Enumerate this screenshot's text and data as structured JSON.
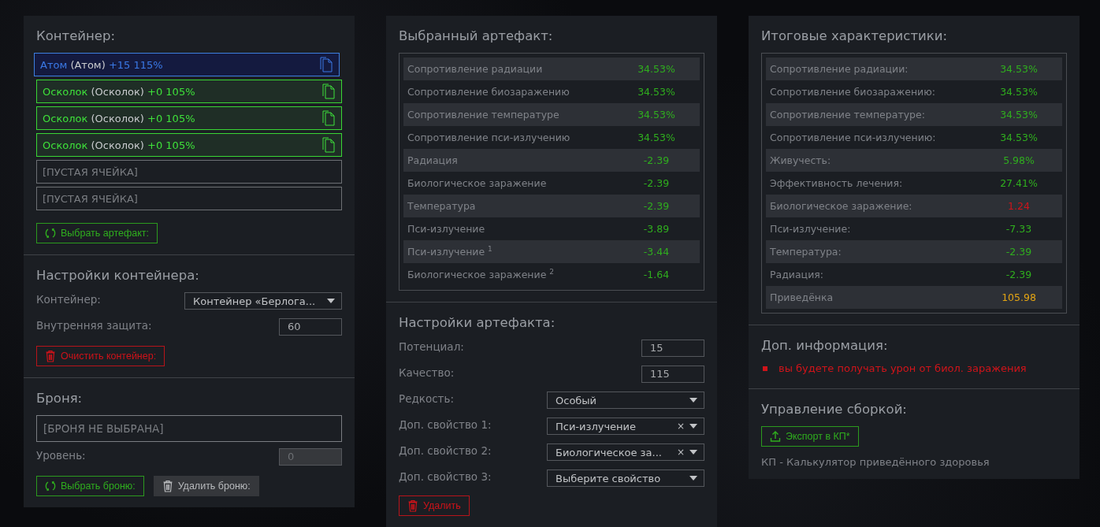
{
  "container": {
    "title": "Контейнер:",
    "slots": [
      {
        "kind": "artifact",
        "selected": true,
        "name": "Атом",
        "type": "(Атом)",
        "bonus": "+15 115%"
      },
      {
        "kind": "artifact",
        "selected": false,
        "name": "Осколок",
        "type": "(Осколок)",
        "bonus": "+0 105%"
      },
      {
        "kind": "artifact",
        "selected": false,
        "name": "Осколок",
        "type": "(Осколок)",
        "bonus": "+0 105%"
      },
      {
        "kind": "artifact",
        "selected": false,
        "name": "Осколок",
        "type": "(Осколок)",
        "bonus": "+0 105%"
      },
      {
        "kind": "empty",
        "label": "[ПУСТАЯ ЯЧЕЙКА]"
      },
      {
        "kind": "empty",
        "label": "[ПУСТАЯ ЯЧЕЙКА]"
      }
    ],
    "button": {
      "kind": "select",
      "label": "Выбрать артефакт:"
    }
  },
  "container_settings": {
    "title": "Настройки контейнера:",
    "fields": [
      {
        "kind": "select",
        "label": "Контейнер:",
        "value": "Контейнер «Берлога...",
        "disabled": false
      },
      {
        "kind": "input",
        "label": "Внутренняя защита:",
        "value": "60",
        "disabled": false
      }
    ],
    "buttons": [
      {
        "kind": "danger",
        "label": "Очистить контейнер:"
      }
    ]
  },
  "armor": {
    "title": "Броня:",
    "slot": "[БРОНЯ НЕ ВЫБРАНА]",
    "fields": [
      {
        "kind": "input",
        "label": "Уровень:",
        "value": "0",
        "disabled": true
      }
    ],
    "buttons": [
      {
        "kind": "select",
        "label": "Выбрать броню:"
      },
      {
        "kind": "muted",
        "label": "Удалить броню:"
      }
    ]
  },
  "selected_artifact": {
    "title": "Выбранный артефакт:",
    "stats": [
      {
        "label": "Сопротивление радиации",
        "value": "34.53%",
        "color": "#2fae1e"
      },
      {
        "label": "Сопротивление биозаражению",
        "value": "34.53%",
        "color": "#2fae1e"
      },
      {
        "label": "Сопротивление температуре",
        "value": "34.53%",
        "color": "#2fae1e"
      },
      {
        "label": "Сопротивление пси-излучению",
        "value": "34.53%",
        "color": "#2fae1e"
      },
      {
        "label": "Радиация",
        "value": "-2.39",
        "color": "#2fae1e"
      },
      {
        "label": "Биологическое заражение",
        "value": "-2.39",
        "color": "#2fae1e"
      },
      {
        "label": "Температура",
        "value": "-2.39",
        "color": "#2fae1e"
      },
      {
        "label": "Пси-излучение",
        "value": "-3.89",
        "color": "#2fae1e"
      },
      {
        "label": "Пси-излучение $^{1}$",
        "value": "-3.44",
        "color": "#2fae1e"
      },
      {
        "label": "Биологическое заражение $^{2}$",
        "value": "-1.64",
        "color": "#2fae1e"
      }
    ]
  },
  "artifact_settings": {
    "title": "Настройки артефакта:",
    "fields": [
      {
        "kind": "input",
        "label": "Потенциал:",
        "value": "15",
        "disabled": false
      },
      {
        "kind": "input",
        "label": "Качество:",
        "value": "115",
        "disabled": false
      },
      {
        "kind": "select",
        "label": "Редкость:",
        "value": "Особый",
        "disabled": false
      },
      {
        "kind": "select",
        "label": "Доп. свойство 1:",
        "value": "Пси-излучение",
        "clear": "×",
        "disabled": false
      },
      {
        "kind": "select",
        "label": "Доп. свойство 2:",
        "value": "Биологическое за...",
        "clear": "×",
        "disabled": false
      },
      {
        "kind": "select",
        "label": "Доп. свойство 3:",
        "value": "Выберите свойство",
        "disabled": false
      }
    ],
    "buttons": [
      {
        "kind": "danger",
        "label": "Удалить"
      }
    ]
  },
  "total_stats": {
    "title": "Итоговые характеристики:",
    "stats": [
      {
        "label": "Сопротивление радиации:",
        "value": "34.53%",
        "color": "#2fae1e"
      },
      {
        "label": "Сопротивление биозаражению:",
        "value": "34.53%",
        "color": "#2fae1e"
      },
      {
        "label": "Сопротивление температуре:",
        "value": "34.53%",
        "color": "#2fae1e"
      },
      {
        "label": "Сопротивление пси-излучению:",
        "value": "34.53%",
        "color": "#2fae1e"
      },
      {
        "label": "Живучесть:",
        "value": "5.98%",
        "color": "#2fae1e"
      },
      {
        "label": "Эффективность лечения:",
        "value": "27.41%",
        "color": "#2fae1e"
      },
      {
        "label": "Биологическое заражение:",
        "value": "1.24",
        "color": "#d0141a"
      },
      {
        "label": "Пси-излучение:",
        "value": "-7.33",
        "color": "#2fae1e"
      },
      {
        "label": "Температура:",
        "value": "-2.39",
        "color": "#2fae1e"
      },
      {
        "label": "Радиация:",
        "value": "-2.39",
        "color": "#2fae1e"
      },
      {
        "label": "Приведёнка",
        "value": "105.98",
        "color": "#e3a413"
      }
    ]
  },
  "extra_info": {
    "title": "Доп. информация:",
    "items": [
      {
        "text": "вы будете получать урон от биол. заражения",
        "color": "#d0141a"
      }
    ]
  },
  "build_management": {
    "title": "Управление сборкой:",
    "buttons": [
      {
        "kind": "export",
        "label": "Экспорт в КП*"
      }
    ],
    "note": "КП - Калькулятор приведённого здоровья"
  }
}
